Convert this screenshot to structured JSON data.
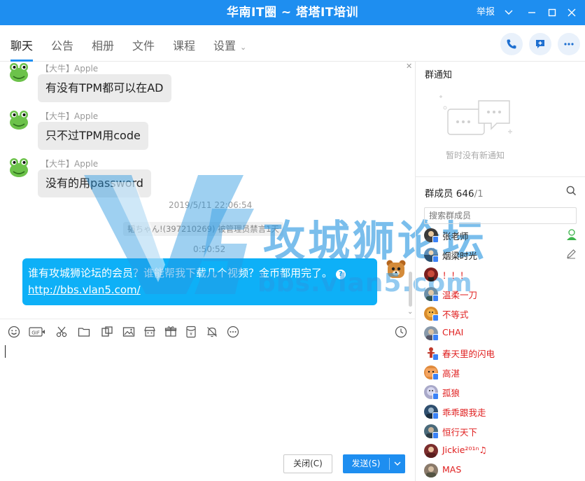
{
  "window": {
    "title": "华南IT圈 ~ 塔塔IT培训",
    "report_label": "举报"
  },
  "tabs": [
    {
      "label": "聊天"
    },
    {
      "label": "公告"
    },
    {
      "label": "相册"
    },
    {
      "label": "文件"
    },
    {
      "label": "课程"
    },
    {
      "label": "设置"
    }
  ],
  "messages": [
    {
      "sender": "【大牛】Apple",
      "text": "有没有TPM都可以在AD"
    },
    {
      "sender": "【大牛】Apple",
      "text": "只不过TPM用code"
    },
    {
      "sender": "【大牛】Apple",
      "text": "没有的用password"
    }
  ],
  "timestamps": [
    "2019/5/11 22:06:54",
    "0:50:52"
  ],
  "system_note": "韬ちゃん!(397210269) 被管理员禁言1天",
  "own_message": {
    "text": "谁有攻城狮论坛的会员？谁能帮我下载几个视频？金币都用完了。",
    "link": "http://bbs.vlan5.com/"
  },
  "watermark": {
    "cn": "攻城狮论坛",
    "en": "bbs.vlan5.com"
  },
  "buttons": {
    "close": "关闭(C)",
    "send": "发送(S)"
  },
  "notice": {
    "title": "群通知",
    "empty": "暂时没有新通知"
  },
  "members": {
    "title": "群成员",
    "count": "646",
    "total": "/1",
    "search_placeholder": "搜索群成员",
    "list": [
      {
        "name": "张老师",
        "color": "black"
      },
      {
        "name": "烟梁时光",
        "color": "black"
      },
      {
        "name": "！！！",
        "color": "red"
      },
      {
        "name": "温柔一刀",
        "color": "red"
      },
      {
        "name": "不等式",
        "color": "red"
      },
      {
        "name": "CHAI",
        "color": "red"
      },
      {
        "name": "春天里的闪电",
        "color": "red"
      },
      {
        "name": "高湛",
        "color": "red"
      },
      {
        "name": "孤狼",
        "color": "red"
      },
      {
        "name": "乖乖跟我走",
        "color": "red"
      },
      {
        "name": "恒行天下",
        "color": "red"
      },
      {
        "name": "Jickie²⁰¹ⁿ♫",
        "color": "red"
      },
      {
        "name": "MAS",
        "color": "red"
      }
    ]
  },
  "colors": {
    "accent": "#1e8ef0",
    "own_bubble": "#0eb0f7",
    "member_red": "#e02020"
  }
}
